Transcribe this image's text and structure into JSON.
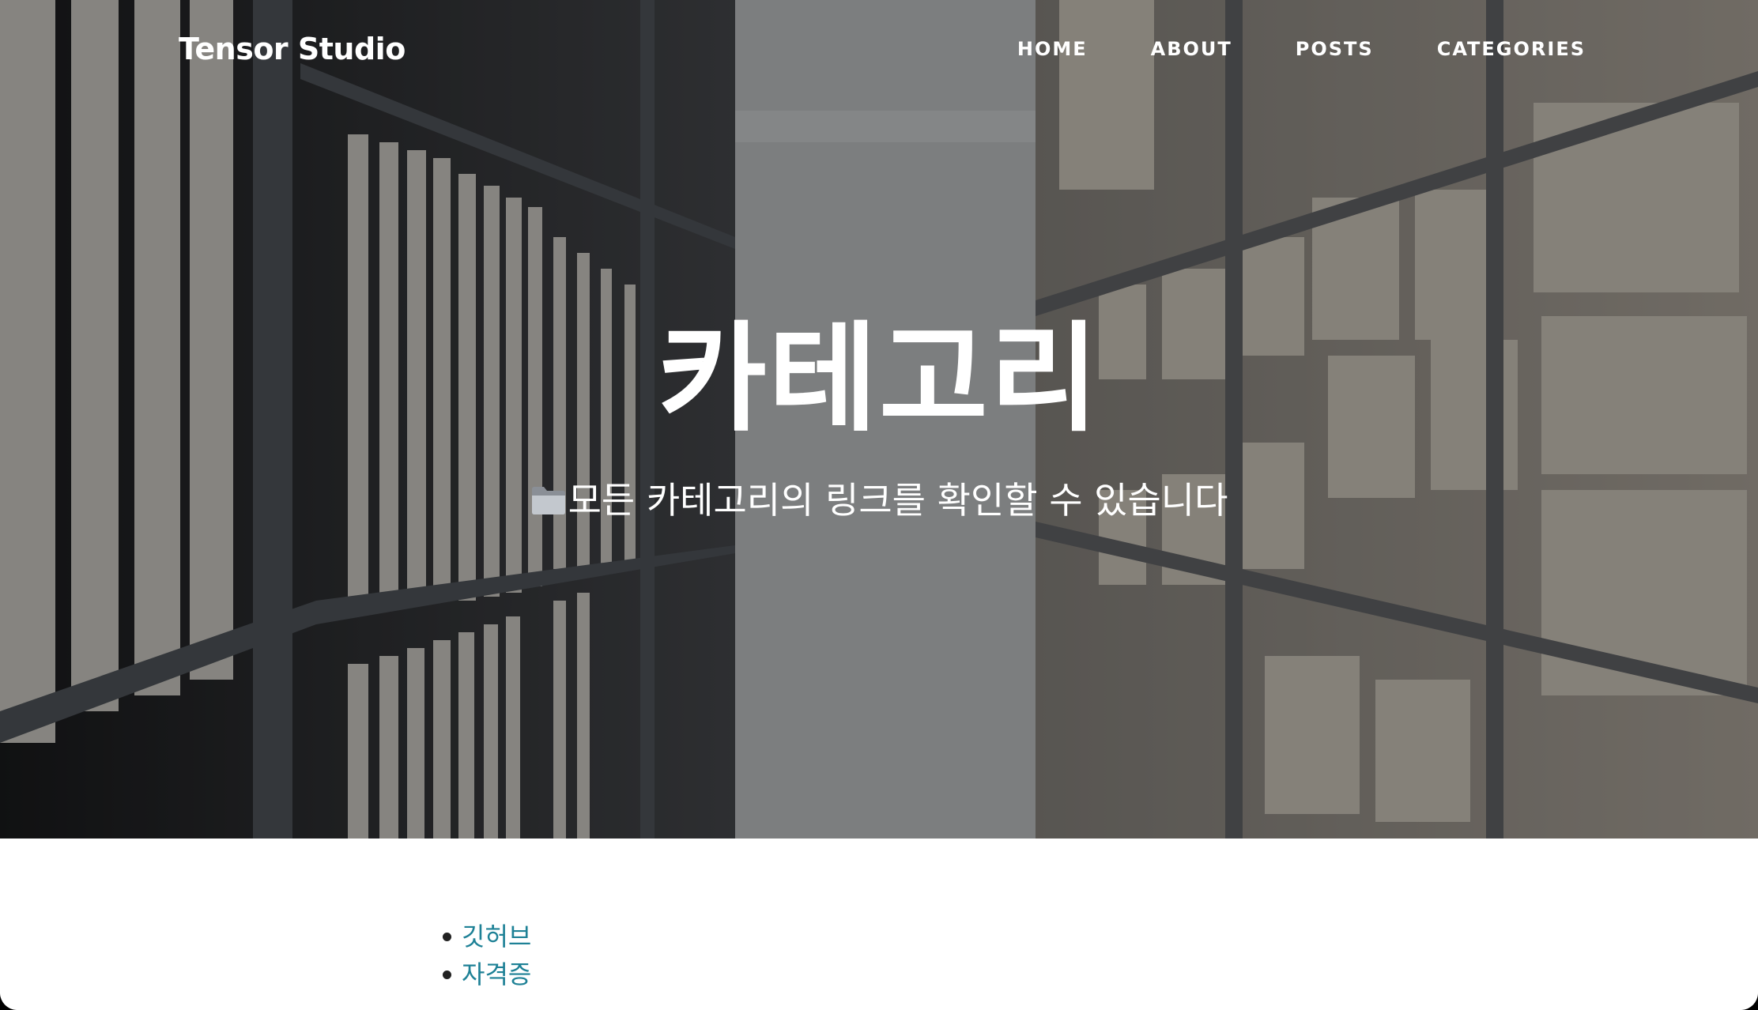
{
  "header": {
    "brand": "Tensor Studio",
    "nav": [
      "HOME",
      "ABOUT",
      "POSTS",
      "CATEGORIES"
    ]
  },
  "hero": {
    "title": "카테고리",
    "subtitle": "모든 카테고리의 링크를 확인할 수 있습니다",
    "subtitle_icon": "folder-icon"
  },
  "categories": [
    "깃허브",
    "자격증"
  ],
  "colors": {
    "link": "#1e8196",
    "nav_text": "#ffffff",
    "page_background": "#ffffff"
  }
}
